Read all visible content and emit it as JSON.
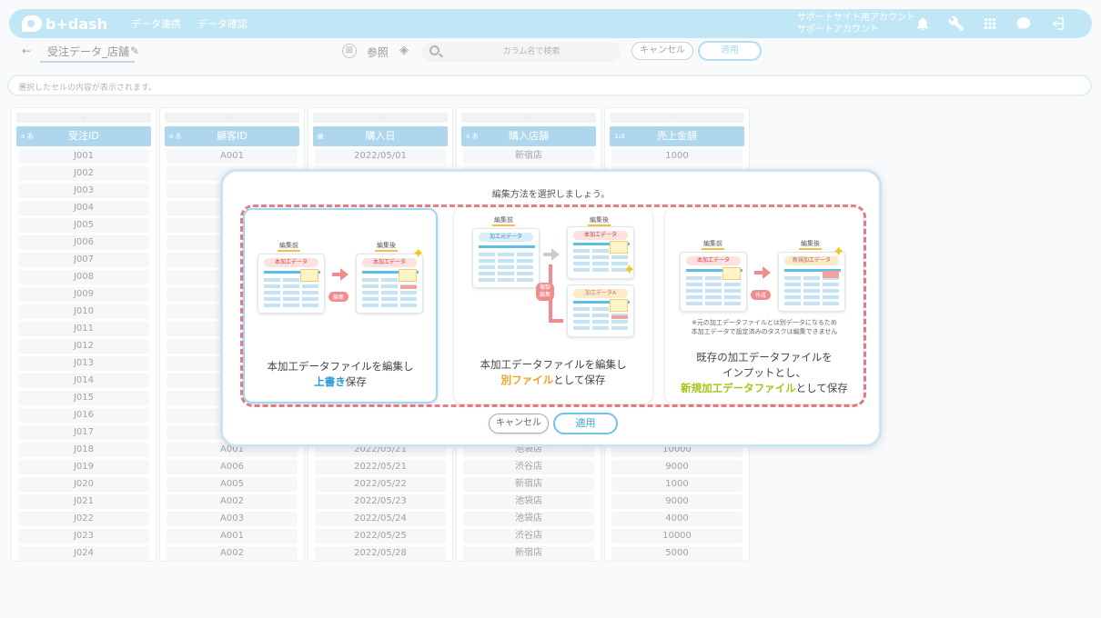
{
  "topbar": {
    "logo": "b+dash",
    "nav": [
      "データ連携",
      "データ確認"
    ],
    "account_line1": "サポートサイト用アカウント",
    "account_line2": "サポートアカウント",
    "icons": [
      "bell-icon",
      "wrench-icon",
      "apps-grid-icon",
      "chat-icon",
      "logout-icon"
    ]
  },
  "subheader": {
    "back": "←",
    "sheet_name": "受注データ_店舗",
    "mode_label": "参照",
    "search_placeholder": "カラム名で検索",
    "cancel": "キャンセル",
    "apply": "適用"
  },
  "cellbar": {
    "text": "選択したセルの内容が表示されます。",
    "chevron": "⌄"
  },
  "columns": [
    {
      "type_icon": "a あ",
      "header": "受注ID",
      "cells": [
        "J001",
        "J002",
        "J003",
        "J004",
        "J005",
        "J006",
        "J007",
        "J008",
        "J009",
        "J010",
        "J011",
        "J012",
        "J013",
        "J014",
        "J015",
        "J016",
        "J017",
        "J018",
        "J019",
        "J020",
        "J021",
        "J022",
        "J023",
        "J024"
      ]
    },
    {
      "type_icon": "a あ",
      "header": "顧客ID",
      "cells": [
        "A001",
        "",
        "",
        "",
        "",
        "",
        "",
        "",
        "",
        "",
        "",
        "",
        "",
        "",
        "",
        "",
        "",
        "A001",
        "A006",
        "A005",
        "A002",
        "A003",
        "A001",
        "A002"
      ]
    },
    {
      "type_icon": "▦",
      "header": "購入日",
      "cells": [
        "2022/05/01",
        "",
        "",
        "",
        "",
        "",
        "",
        "",
        "",
        "",
        "",
        "",
        "",
        "",
        "",
        "",
        "",
        "2022/05/21",
        "2022/05/21",
        "2022/05/22",
        "2022/05/23",
        "2022/05/24",
        "2022/05/25",
        "2022/05/28"
      ]
    },
    {
      "type_icon": "a あ",
      "header": "購入店舗",
      "cells": [
        "新宿店",
        "",
        "",
        "",
        "",
        "",
        "",
        "",
        "",
        "",
        "",
        "",
        "",
        "",
        "",
        "",
        "",
        "池袋店",
        "渋谷店",
        "新宿店",
        "池袋店",
        "池袋店",
        "渋谷店",
        "新宿店"
      ]
    },
    {
      "type_icon": "1₂3",
      "header": "売上金額",
      "cells": [
        "1000",
        "",
        "",
        "",
        "",
        "",
        "",
        "",
        "",
        "",
        "",
        "",
        "",
        "",
        "",
        "",
        "",
        "10000",
        "9000",
        "1000",
        "9000",
        "4000",
        "10000",
        "5000"
      ]
    }
  ],
  "modal": {
    "title": "編集方法を選択しましょう。",
    "options": [
      {
        "before_label": "編集前",
        "after_label": "編集後",
        "sheet_before": "本加工データ",
        "sheet_after": "本加工データ",
        "action": "編集",
        "caption_1": "本加工データファイルを編集し",
        "caption_hl": "上書き",
        "caption_2": "保存"
      },
      {
        "before_label": "編集前",
        "after_label": "編集後",
        "sheet_source": "加工元データ",
        "sheet_main": "本加工データ",
        "sheet_copy": "加工データA",
        "action": "複製\n編集",
        "caption_1": "本加工データファイルを編集し",
        "caption_hl": "別ファイル",
        "caption_2": "として保存"
      },
      {
        "before_label": "編集前",
        "after_label": "編集後",
        "sheet_before": "本加工データ",
        "sheet_after": "新規加工データ",
        "action": "作成",
        "note_1": "※元の加工データファイルとは別データになるため",
        "note_2": "本加工データで設定済みのタスクは編集できません",
        "caption_1": "既存の加工データファイルを",
        "caption_2": "インプットとし、",
        "caption_hl": "新規加工データファイル",
        "caption_3": "として保存"
      }
    ],
    "cancel": "キャンセル",
    "apply": "適用"
  }
}
